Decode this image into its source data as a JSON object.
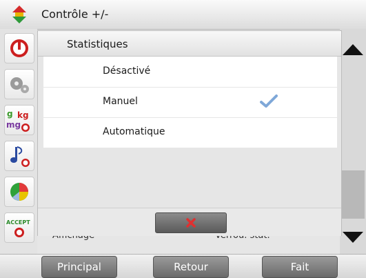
{
  "header": {
    "title": "Contrôle +/-",
    "icon": "up-down-arrow-icon"
  },
  "dialog": {
    "title": "Statistiques",
    "options": [
      {
        "label": "Désactivé",
        "selected": false
      },
      {
        "label": "Manuel",
        "selected": true
      },
      {
        "label": "Automatique",
        "selected": false
      }
    ],
    "cancel_icon": "close-x-icon"
  },
  "rail": {
    "icons": [
      "power-icon",
      "gears-icon",
      "units-g-kg-mg-icon",
      "audio-note-icon",
      "color-pie-icon",
      "accept-icon"
    ],
    "unit_labels": {
      "g": "g",
      "kg": "kg",
      "mg": "mg"
    },
    "accept_text": "ACCEPT"
  },
  "background": {
    "row_left": "Affichage",
    "row_right": "Verrou. stat."
  },
  "footer": {
    "principal": "Principal",
    "retour": "Retour",
    "fait": "Fait"
  },
  "colors": {
    "accent_red": "#cc1f1f",
    "check_blue": "#7fa8d8"
  }
}
